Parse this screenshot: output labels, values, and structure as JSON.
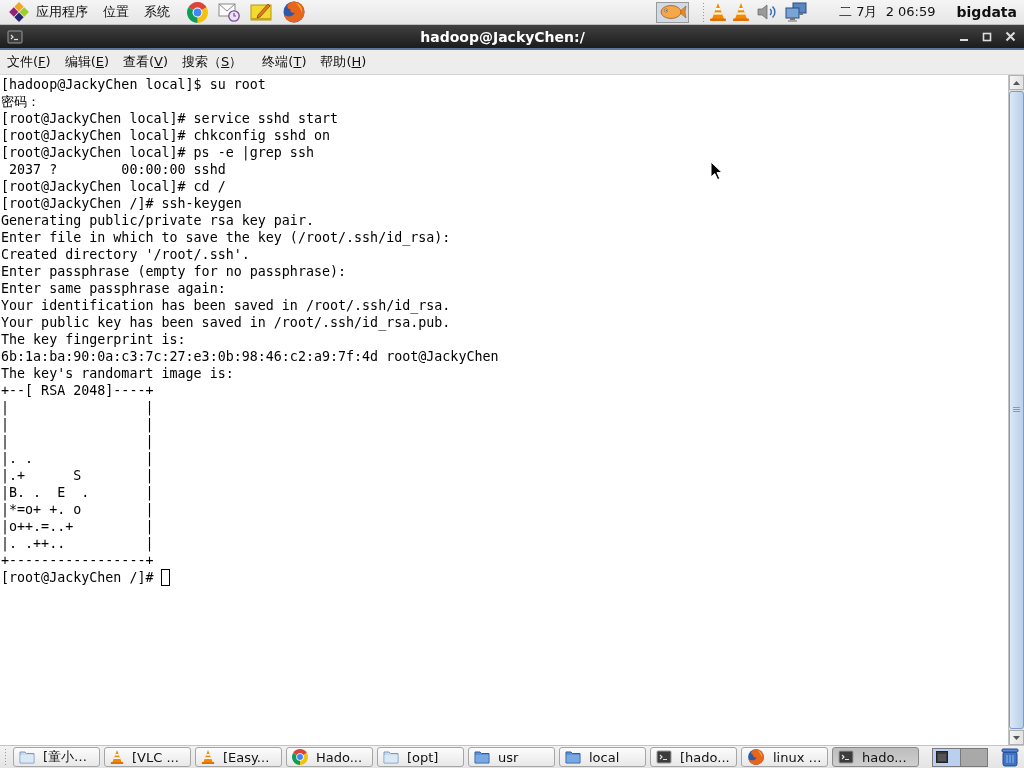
{
  "top_panel": {
    "menus": [
      "应用程序",
      "位置",
      "系统"
    ],
    "clock": "二 7月  2 06:59",
    "user": "bigdata"
  },
  "window": {
    "title": "hadoop@JackyChen:/"
  },
  "menu_bar": {
    "items": [
      {
        "text_before": "文件(",
        "mnemonic": "F",
        "text_after": ")"
      },
      {
        "text_before": "编辑(",
        "mnemonic": "E",
        "text_after": ")"
      },
      {
        "text_before": "查看(",
        "mnemonic": "V",
        "text_after": ")"
      },
      {
        "text_before": "搜索（",
        "mnemonic": "S",
        "text_after": "）"
      },
      {
        "text_before": "终端(",
        "mnemonic": "T",
        "text_after": ")"
      },
      {
        "text_before": "帮助(",
        "mnemonic": "H",
        "text_after": ")"
      }
    ]
  },
  "terminal": {
    "lines": [
      "[hadoop@JackyChen local]$ su root",
      "密码：",
      "[root@JackyChen local]# service sshd start",
      "[root@JackyChen local]# chkconfig sshd on",
      "[root@JackyChen local]# ps -e |grep ssh",
      " 2037 ?        00:00:00 sshd",
      "[root@JackyChen local]# cd /",
      "[root@JackyChen /]# ssh-keygen",
      "Generating public/private rsa key pair.",
      "Enter file in which to save the key (/root/.ssh/id_rsa):",
      "Created directory '/root/.ssh'.",
      "Enter passphrase (empty for no passphrase):",
      "Enter same passphrase again:",
      "Your identification has been saved in /root/.ssh/id_rsa.",
      "Your public key has been saved in /root/.ssh/id_rsa.pub.",
      "The key fingerprint is:",
      "6b:1a:ba:90:0a:c3:7c:27:e3:0b:98:46:c2:a9:7f:4d root@JackyChen",
      "The key's randomart image is:",
      "+--[ RSA 2048]----+",
      "|                 |",
      "|                 |",
      "|                 |",
      "|. .              |",
      "|.+      S        |",
      "|B. .  E  .       |",
      "|*=o+ +. o        |",
      "|o++.=..+         |",
      "|. .++..          |",
      "+-----------------+"
    ],
    "prompt": "[root@JackyChen /]#"
  },
  "taskbar": {
    "tasks": [
      {
        "label": "[童小…",
        "kind": "folder",
        "selected": false
      },
      {
        "label": "[VLC ...",
        "kind": "cone",
        "selected": false
      },
      {
        "label": "[Easy...",
        "kind": "cone",
        "selected": false
      },
      {
        "label": "Hado...",
        "kind": "chrome",
        "selected": false
      },
      {
        "label": "[opt]",
        "kind": "folder",
        "selected": false
      },
      {
        "label": "usr",
        "kind": "bluefolder",
        "selected": false
      },
      {
        "label": "local",
        "kind": "bluefolder",
        "selected": false
      },
      {
        "label": "[hado...",
        "kind": "terminal",
        "selected": false
      },
      {
        "label": "linux …",
        "kind": "firefox",
        "selected": false
      },
      {
        "label": "hado...",
        "kind": "terminal",
        "selected": true
      }
    ],
    "workspaces": [
      {
        "selected": true
      },
      {
        "selected": false
      }
    ]
  }
}
